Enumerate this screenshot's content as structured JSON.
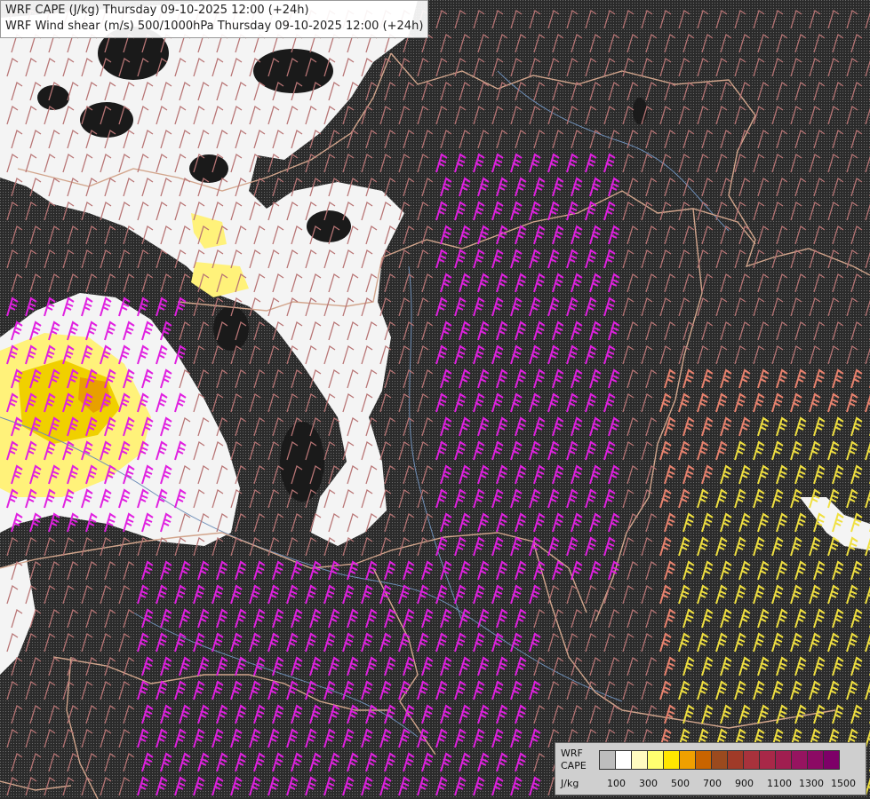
{
  "header": {
    "line1": "WRF CAPE (J/kg) Thursday 09-10-2025 12:00 (+24h)",
    "line2": "WRF Wind shear (m/s) 500/1000hPa Thursday 09-10-2025 12:00 (+24h)"
  },
  "legend": {
    "label_top": "WRF",
    "label_mid": "CAPE",
    "label_unit": "J/kg",
    "swatch_colors": [
      "#bdbdbd",
      "#ffffff",
      "#fffbc0",
      "#ffff70",
      "#ffe600",
      "#f0a000",
      "#c86400",
      "#9b4a1e",
      "#a03a28",
      "#a8323c",
      "#a82848",
      "#a01e50",
      "#961460",
      "#8c0a64",
      "#7e0068"
    ],
    "tick_labels": [
      "100",
      "300",
      "500",
      "700",
      "900",
      "1100",
      "1300",
      "1500"
    ]
  },
  "map_colors": {
    "background": "#2b2b2b",
    "cloud_white": "#f4f4f4",
    "border_lines": "#d2a58c",
    "rivers": "#6f8fb8",
    "barb_strong": "#e020e0",
    "barb_medium": "#b87575",
    "barb_salmon": "#e8826e",
    "barb_yellow": "#f0e040",
    "cape_low": "#fff27a",
    "cape_mid": "#e8a000"
  }
}
